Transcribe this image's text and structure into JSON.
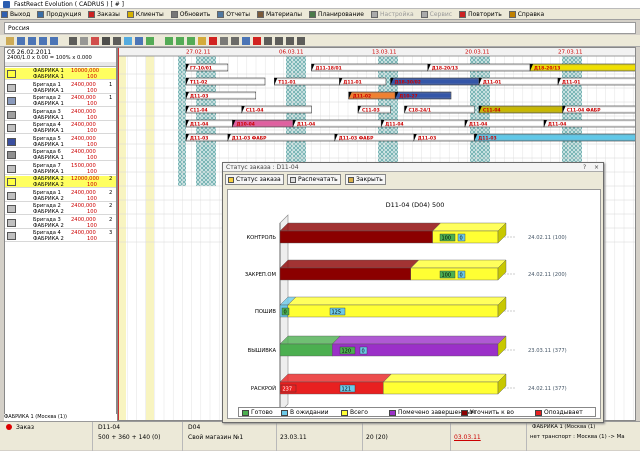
{
  "app": {
    "title": "FastReact Evolution  ( CADRUS ) [ # ]",
    "min": "_",
    "max": "□",
    "close": "X"
  },
  "menu": [
    {
      "label": "Выход",
      "icon": "exit-icon",
      "color": "#3060b0",
      "enabled": true
    },
    {
      "label": "Продукция",
      "icon": "products-icon",
      "color": "#3a6ea5",
      "enabled": true
    },
    {
      "label": "Заказы",
      "icon": "orders-icon",
      "color": "#cc2222",
      "enabled": true
    },
    {
      "label": "Клиенты",
      "icon": "clients-icon",
      "color": "#d4b000",
      "enabled": true
    },
    {
      "label": "Обновить",
      "icon": "refresh-icon",
      "color": "#777777",
      "enabled": true
    },
    {
      "label": "Отчеты",
      "icon": "reports-icon",
      "color": "#5078a0",
      "enabled": true
    },
    {
      "label": "Материалы",
      "icon": "materials-icon",
      "color": "#7b5b3a",
      "enabled": true
    },
    {
      "label": "Планирование",
      "icon": "planning-icon",
      "color": "#4a7a4a",
      "enabled": true
    },
    {
      "label": "Настройка",
      "icon": "settings-icon",
      "color": "#aaaaaa",
      "enabled": false
    },
    {
      "label": "Сервис",
      "icon": "service-icon",
      "color": "#aaaaaa",
      "enabled": false
    },
    {
      "label": "Повторить",
      "icon": "repeat-icon",
      "color": "#cc2222",
      "enabled": true
    },
    {
      "label": "Справка",
      "icon": "help-icon",
      "color": "#c08000",
      "enabled": true
    }
  ],
  "region": "Россия",
  "left": {
    "date": "Сб 26.02.2011",
    "sub": "2400/1.0 x 0.00 = 100% x 0.000",
    "rows": [
      {
        "n1": "ФАБРИКА 1",
        "n2": "ФАБРИКА 1",
        "v1": "10000,000",
        "v2": "100",
        "r": "",
        "sw": "#ffff40",
        "hl": true
      },
      {
        "n1": "Бригада 1",
        "n2": "ФАБРИКА 1",
        "v1": "2400,000",
        "v2": "100",
        "r": "1",
        "sw": "#c0c0c0",
        "hl": false
      },
      {
        "n1": "Бригада 2",
        "n2": "ФАБРИКА 1",
        "v1": "2400,000",
        "v2": "100",
        "r": "1",
        "sw": "#8a9abc",
        "hl": false
      },
      {
        "n1": "Бригада 3",
        "n2": "ФАБРИКА 1",
        "v1": "2400,000",
        "v2": "100",
        "r": "",
        "sw": "#a0a0a0",
        "hl": false
      },
      {
        "n1": "Бригада 4",
        "n2": "ФАБРИКА 1",
        "v1": "2400,000",
        "v2": "100",
        "r": "",
        "sw": "#c0c0c0",
        "hl": false
      },
      {
        "n1": "Бригада 5",
        "n2": "ФАБРИКА 1",
        "v1": "2400,000",
        "v2": "100",
        "r": "",
        "sw": "#3b4fa0",
        "hl": false
      },
      {
        "n1": "Бригада 6",
        "n2": "ФАБРИКА 1",
        "v1": "2400,000",
        "v2": "100",
        "r": "",
        "sw": "#909090",
        "hl": false
      },
      {
        "n1": "Бригада 7",
        "n2": "ФАБРИКА 1",
        "v1": "1500,000",
        "v2": "100",
        "r": "",
        "sw": "#c0c0c0",
        "hl": false
      },
      {
        "n1": "ФАБРИКА 2",
        "n2": "ФАБРИКА 2",
        "v1": "12000,000",
        "v2": "100",
        "r": "2",
        "sw": "#ffff40",
        "hl": true
      },
      {
        "n1": "Бригада 1",
        "n2": "ФАБРИКА 2",
        "v1": "2400,000",
        "v2": "100",
        "r": "2",
        "sw": "#c0c0c0",
        "hl": false
      },
      {
        "n1": "Бригада 2",
        "n2": "ФАБРИКА 2",
        "v1": "2400,000",
        "v2": "100",
        "r": "2",
        "sw": "#c0c0c0",
        "hl": false
      },
      {
        "n1": "Бригада 3",
        "n2": "ФАБРИКА 2",
        "v1": "2400,000",
        "v2": "100",
        "r": "2",
        "sw": "#c0c0c0",
        "hl": false
      },
      {
        "n1": "Бригада 4",
        "n2": "ФАБРИКА 2",
        "v1": "2400,000",
        "v2": "100",
        "r": "3",
        "sw": "#c0c0c0",
        "hl": false
      }
    ],
    "footer": "ФАБРИКА 1 (Москва (1))"
  },
  "gantt": {
    "dates": [
      "27.02.11",
      "06.03.11",
      "13.03.11",
      "20.03.11",
      "27.03.11"
    ],
    "bars": [
      {
        "row": 0,
        "label": "Г7-10/01",
        "color": "#ffffff",
        "s": 0.03,
        "e": 0.12
      },
      {
        "row": 0,
        "label": "Д11-18/01",
        "color": "#ffffff",
        "s": 0.3,
        "e": 0.55
      },
      {
        "row": 0,
        "label": "Д18-20/13",
        "color": "#ffffff",
        "s": 0.55,
        "e": 0.77
      },
      {
        "row": 0,
        "label": "Д18-20/13",
        "color": "#f0e000",
        "s": 0.77,
        "e": 1.0
      },
      {
        "row": 1,
        "label": "Т11-02",
        "color": "#ffffff",
        "s": 0.03,
        "e": 0.2
      },
      {
        "row": 1,
        "label": "Т11-01",
        "color": "#ffffff",
        "s": 0.22,
        "e": 0.36
      },
      {
        "row": 1,
        "label": "Д11-01",
        "color": "#ffffff",
        "s": 0.36,
        "e": 0.46
      },
      {
        "row": 1,
        "label": "Д18-30/02",
        "color": "#3456a8",
        "s": 0.47,
        "e": 0.66
      },
      {
        "row": 1,
        "label": "Д11-01",
        "color": "#ffffff",
        "s": 0.66,
        "e": 0.83
      },
      {
        "row": 1,
        "label": "Д11-01",
        "color": "#ffffff",
        "s": 0.83,
        "e": 1.0
      },
      {
        "row": 2,
        "label": "Д11-03",
        "color": "#ffffff",
        "s": 0.03,
        "e": 0.18
      },
      {
        "row": 2,
        "label": "Д11-02",
        "color": "#f08030",
        "s": 0.38,
        "e": 0.48
      },
      {
        "row": 2,
        "label": "Д10-27",
        "color": "#3456a8",
        "s": 0.48,
        "e": 0.6
      },
      {
        "row": 3,
        "label": "С11-04",
        "color": "#ffffff",
        "s": 0.03,
        "e": 0.15
      },
      {
        "row": 3,
        "label": "С11-04",
        "color": "#ffffff",
        "s": 0.15,
        "e": 0.3
      },
      {
        "row": 3,
        "label": "С11-03",
        "color": "#ffffff",
        "s": 0.4,
        "e": 0.47
      },
      {
        "row": 3,
        "label": "С18-24/1",
        "color": "#ffffff",
        "s": 0.5,
        "e": 0.65
      },
      {
        "row": 3,
        "label": "С11-04",
        "color": "#c8b800",
        "s": 0.66,
        "e": 0.84
      },
      {
        "row": 3,
        "label": "С11-04 ФАБР",
        "color": "#ffffff",
        "s": 0.84,
        "e": 1.0
      },
      {
        "row": 4,
        "label": "Д11-04",
        "color": "#ffffff",
        "s": 0.03,
        "e": 0.13
      },
      {
        "row": 4,
        "label": "Д10-04",
        "color": "#e060a0",
        "s": 0.13,
        "e": 0.26
      },
      {
        "row": 4,
        "label": "Д11-04",
        "color": "#ffffff",
        "s": 0.26,
        "e": 0.45
      },
      {
        "row": 4,
        "label": "Д11-04",
        "color": "#ffffff",
        "s": 0.45,
        "e": 0.63
      },
      {
        "row": 4,
        "label": "Д11-04",
        "color": "#ffffff",
        "s": 0.63,
        "e": 0.8
      },
      {
        "row": 4,
        "label": "Д11-04",
        "color": "#ffffff",
        "s": 0.8,
        "e": 1.0
      },
      {
        "row": 5,
        "label": "Д11-03",
        "color": "#ffffff",
        "s": 0.03,
        "e": 0.12
      },
      {
        "row": 5,
        "label": "Д11-03 ФАБР",
        "color": "#ffffff",
        "s": 0.12,
        "e": 0.35
      },
      {
        "row": 5,
        "label": "Д11-03 ФАБР",
        "color": "#ffffff",
        "s": 0.35,
        "e": 0.52
      },
      {
        "row": 5,
        "label": "Д11-03",
        "color": "#ffffff",
        "s": 0.52,
        "e": 0.65
      },
      {
        "row": 5,
        "label": "Д11-03",
        "color": "#60c8e8",
        "s": 0.65,
        "e": 1.0
      }
    ]
  },
  "dialog": {
    "title": "Статус заказа : D11-04",
    "buttons": [
      "Статус заказа",
      "Распечатать",
      "Закрыть"
    ],
    "legend": [
      {
        "label": "Готово",
        "color": "#4caf50"
      },
      {
        "label": "В ожидании",
        "color": "#6cc9e8"
      },
      {
        "label": "Всего",
        "color": "#ffff33"
      },
      {
        "label": "Помечено завершенным",
        "color": "#9b30c8"
      },
      {
        "label": "Уточнить к во",
        "color": "#8b0000"
      },
      {
        "label": "Опоздывает",
        "color": "#e82020"
      }
    ]
  },
  "chart_data": {
    "type": "bar",
    "title": "D11-04 (D04) 500",
    "categories": [
      "КОНТРОЛЬ",
      "ЗАКРЕП.ОМ",
      "ПОШИВ",
      "ВЫШИВКА",
      "РАСКРОЙ"
    ],
    "xlim": [
      0,
      500
    ],
    "series": [
      {
        "values": [
          0,
          0,
          0,
          0,
          237
        ],
        "color": "#e82020"
      },
      {
        "values": [
          0,
          0,
          0,
          120,
          0
        ],
        "color": "#4caf50"
      },
      {
        "values": [
          0,
          0,
          18,
          0,
          0
        ],
        "color": "#6cc9e8"
      },
      {
        "values": [
          350,
          300,
          0,
          0,
          0
        ],
        "color": "#8b0000"
      },
      {
        "values": [
          0,
          0,
          0,
          380,
          0
        ],
        "color": "#9b30c8"
      },
      {
        "values": [
          500,
          500,
          500,
          500,
          500
        ],
        "color": "#ffff33"
      }
    ],
    "bar_labels": [
      [
        "100",
        "0"
      ],
      [
        "100",
        "0"
      ],
      [
        "0",
        "125"
      ],
      [
        "120",
        "0"
      ],
      [
        "237",
        "121"
      ]
    ],
    "right_labels": [
      "24.02.11 (100)",
      "24.02.11 (200)",
      "",
      "23.03.11 (377)",
      "24.02.11 (377)"
    ]
  },
  "statusbar": {
    "item": "Заказ",
    "order": "D11-04",
    "order2": "D04",
    "detail": "500 + 360 + 140  (0)",
    "shop": "Свой магазин №1",
    "date": "23.03.11",
    "count": "20 (20)",
    "date2": "03.03.11",
    "transport": "нет транспорт : Москва (1) -> Ма",
    "extra": "ФАБРИКА 1 (Москва (1)"
  }
}
